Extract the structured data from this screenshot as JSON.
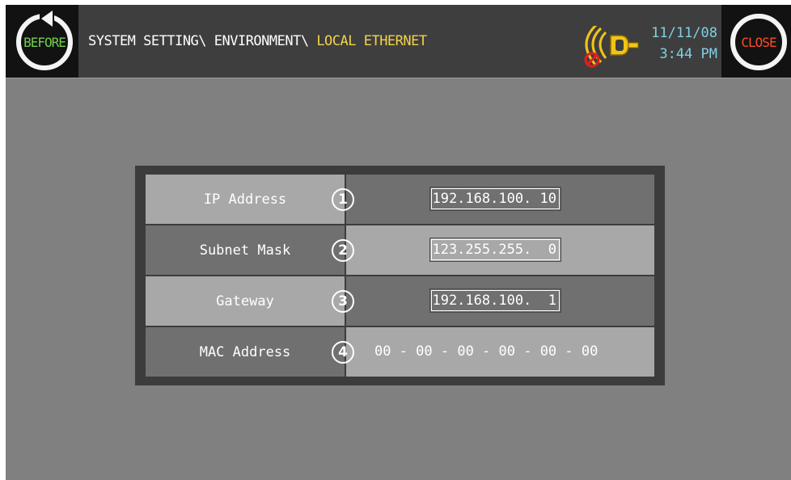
{
  "header": {
    "before_label": "BEFORE",
    "close_label": "CLOSE",
    "breadcrumb_path": "SYSTEM SETTING\\ ENVIRONMENT\\ ",
    "breadcrumb_current": "LOCAL ETHERNET",
    "date": "11/11/08",
    "time": "3:44 PM",
    "network_icon": "ethernet-disconnected-icon"
  },
  "colors": {
    "before": "#6fd04a",
    "close": "#ff4a2a",
    "breadcrumb_current": "#f3d24a",
    "datetime": "#7fd0e4"
  },
  "settings": [
    {
      "label": "IP Address",
      "number": "1",
      "value": "192.168.100. 10"
    },
    {
      "label": "Subnet Mask",
      "number": "2",
      "value": "123.255.255.  0"
    },
    {
      "label": "Gateway",
      "number": "3",
      "value": "192.168.100.  1"
    },
    {
      "label": "MAC Address",
      "number": "4",
      "value": "00 - 00 - 00 - 00 - 00 - 00"
    }
  ]
}
